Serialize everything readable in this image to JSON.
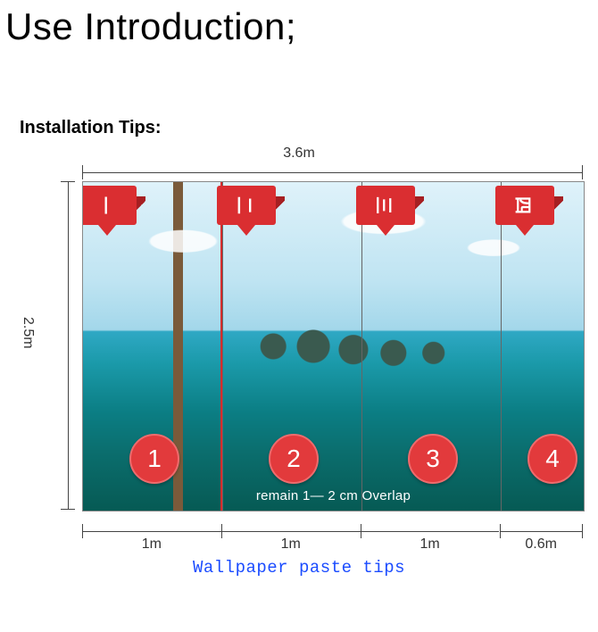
{
  "title": "Use Introduction;",
  "section_heading": "Installation Tips:",
  "mural": {
    "total_width_label": "3.6m",
    "total_height_label": "2.5m",
    "panel_tabs_cn": [
      "一",
      "二",
      "三",
      "四"
    ],
    "panel_numbers": [
      "1",
      "2",
      "3",
      "4"
    ],
    "overlap_note": "remain 1— 2 cm Overlap",
    "panel_widths": [
      "1m",
      "1m",
      "1m",
      "0.6m"
    ]
  },
  "caption": "Wallpaper paste tips",
  "chart_data": {
    "type": "table",
    "description": "Wallpaper mural split into 4 vertical panels with overlap instruction",
    "total_width_m": 3.6,
    "total_height_m": 2.5,
    "panels": [
      {
        "index": 1,
        "cn_numeral": "一",
        "width_m": 1.0
      },
      {
        "index": 2,
        "cn_numeral": "二",
        "width_m": 1.0
      },
      {
        "index": 3,
        "cn_numeral": "三",
        "width_m": 1.0
      },
      {
        "index": 4,
        "cn_numeral": "四",
        "width_m": 0.6
      }
    ],
    "overlap_cm_range": [
      1,
      2
    ]
  }
}
